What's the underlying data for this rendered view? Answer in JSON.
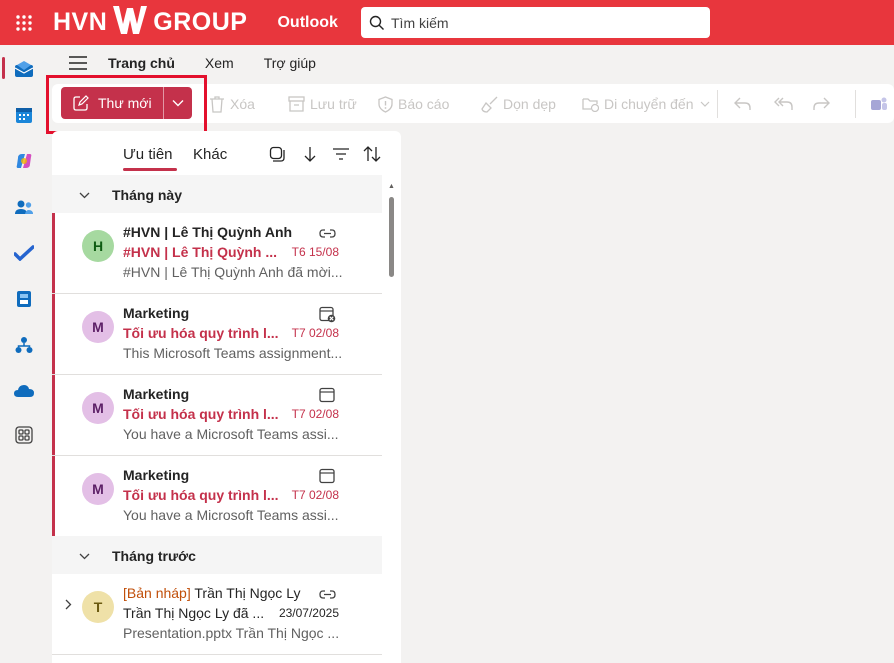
{
  "header": {
    "brand_left": "HVN",
    "brand_right": "GROUP",
    "app_name": "Outlook",
    "search_placeholder": "Tìm kiếm",
    "accent_color": "#e8363d"
  },
  "rail": {
    "items": [
      "mail-icon",
      "calendar-icon",
      "copilot-icon",
      "people-icon",
      "todo-icon",
      "bookings-icon",
      "org-explorer-icon",
      "onedrive-icon",
      "more-apps-icon"
    ]
  },
  "menu": {
    "tabs": [
      "Trang chủ",
      "Xem",
      "Trợ giúp"
    ]
  },
  "ribbon": {
    "new_mail": "Thư mới",
    "delete": "Xóa",
    "archive": "Lưu trữ",
    "report": "Báo cáo",
    "sweep": "Dọn dẹp",
    "move": "Di chuyển đến"
  },
  "list": {
    "focused": "Ưu tiên",
    "other": "Khác",
    "groups": [
      {
        "name": "Tháng này"
      },
      {
        "name": "Tháng trước"
      }
    ],
    "mails": [
      {
        "initial": "H",
        "from": "#HVN | Lê Thị Quỳnh Anh",
        "subject": "#HVN | Lê Thị Quỳnh ...",
        "date": "T6 15/08",
        "preview": "#HVN | Lê Thị Quỳnh Anh đã mời...",
        "icon": "link-icon",
        "avatar_bg": "#a6d9a0",
        "avatar_fg": "#0e5c12"
      },
      {
        "initial": "M",
        "from": "Marketing",
        "subject": "Tối ưu hóa quy trình l...",
        "date": "T7 02/08",
        "preview": "This Microsoft Teams assignment...",
        "icon": "calendar-cancel-icon",
        "avatar_bg": "#e3bfe6",
        "avatar_fg": "#5c1f66"
      },
      {
        "initial": "M",
        "from": "Marketing",
        "subject": "Tối ưu hóa quy trình l...",
        "date": "T7 02/08",
        "preview": "You have a Microsoft Teams assi...",
        "icon": "calendar-icon",
        "avatar_bg": "#e3bfe6",
        "avatar_fg": "#5c1f66"
      },
      {
        "initial": "M",
        "from": "Marketing",
        "subject": "Tối ưu hóa quy trình l...",
        "date": "T7 02/08",
        "preview": "You have a Microsoft Teams assi...",
        "icon": "calendar-icon",
        "avatar_bg": "#e3bfe6",
        "avatar_fg": "#5c1f66"
      }
    ],
    "draft": {
      "initial": "T",
      "tag": "[Bản nháp]",
      "from": "Trần Thị Ngọc Ly",
      "subject": "Trần Thị Ngọc Ly đã ...",
      "date": "23/07/2025",
      "preview": "Presentation.pptx Trần Thị Ngọc ...",
      "icon": "link-icon",
      "avatar_bg": "#efe1a8",
      "avatar_fg": "#6b5a10"
    }
  }
}
